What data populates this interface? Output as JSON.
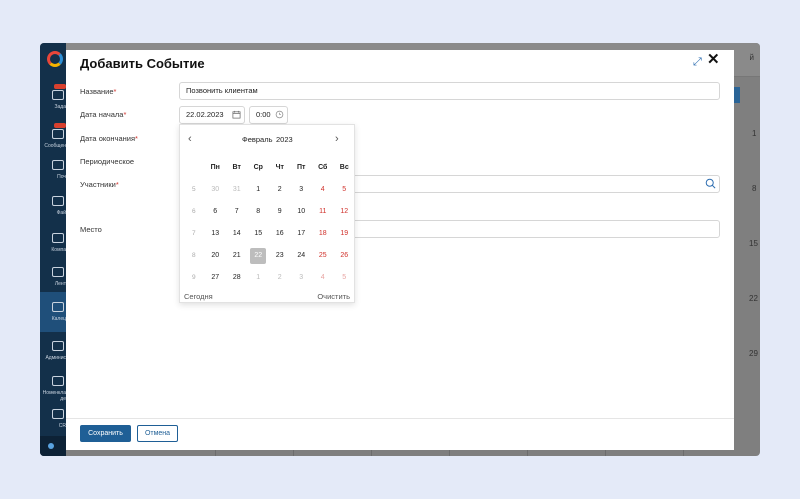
{
  "background_app": {
    "user_suffix": "й",
    "sidebar_items": [
      {
        "label": "Зада",
        "badge": true
      },
      {
        "label": "Сообщен",
        "badge": true
      },
      {
        "label": "Поч"
      },
      {
        "label": "Фай"
      },
      {
        "label": "Компа"
      },
      {
        "label": "Лент"
      },
      {
        "label": "Калец",
        "active": true
      },
      {
        "label": "Админис"
      },
      {
        "label": "Номенкла де"
      },
      {
        "label": "CR"
      }
    ],
    "day_numbers": [
      "1",
      "8",
      "15",
      "22",
      "29"
    ]
  },
  "modal": {
    "title": "Добавить Событие",
    "fields": {
      "name_label": "Название",
      "name_value": "Позвонить клиентам",
      "start_label": "Дата начала",
      "start_date": "22.02.2023",
      "start_time": "0:00",
      "end_label": "Дата окончания",
      "periodic_label": "Периодическое",
      "participants_label": "Участники",
      "place_label": "Место",
      "required_mark": "*"
    },
    "calendar": {
      "month": "Февраль",
      "year": "2023",
      "prev": "‹",
      "next": "›",
      "weekdays": [
        "Пн",
        "Вт",
        "Ср",
        "Чт",
        "Пт",
        "Сб",
        "Вс"
      ],
      "weeks": [
        {
          "wk": "5",
          "days": [
            "30",
            "31",
            "1",
            "2",
            "3",
            "4",
            "5"
          ]
        },
        {
          "wk": "6",
          "days": [
            "6",
            "7",
            "8",
            "9",
            "10",
            "11",
            "12"
          ]
        },
        {
          "wk": "7",
          "days": [
            "13",
            "14",
            "15",
            "16",
            "17",
            "18",
            "19"
          ]
        },
        {
          "wk": "8",
          "days": [
            "20",
            "21",
            "22",
            "23",
            "24",
            "25",
            "26"
          ]
        },
        {
          "wk": "9",
          "days": [
            "27",
            "28",
            "1",
            "2",
            "3",
            "4",
            "5"
          ]
        }
      ],
      "selected_day": "22",
      "today_label": "Сегодня",
      "clear_label": "Очистить"
    },
    "buttons": {
      "save": "Сохранить",
      "cancel": "Отмена"
    }
  },
  "colors": {
    "accent": "#1f5f96",
    "weekend": "#d0302a",
    "required": "#d0302a"
  }
}
